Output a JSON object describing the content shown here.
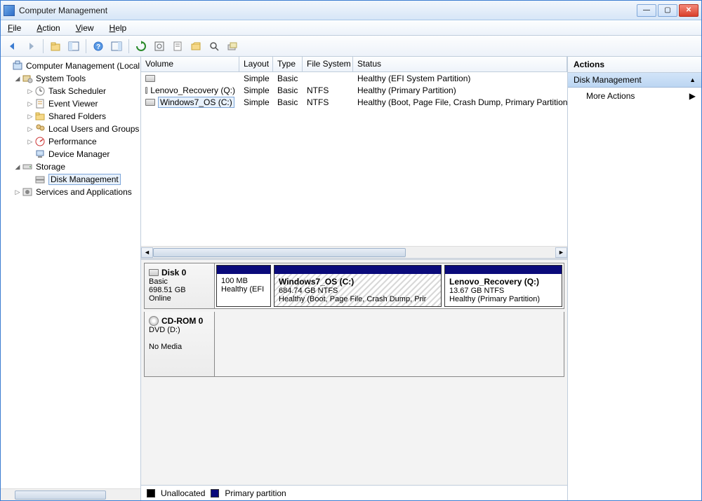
{
  "window": {
    "title": "Computer Management"
  },
  "menu": {
    "file": "File",
    "action": "Action",
    "view": "View",
    "help": "Help"
  },
  "tree": {
    "root": "Computer Management (Local",
    "system_tools": "System Tools",
    "task_scheduler": "Task Scheduler",
    "event_viewer": "Event Viewer",
    "shared_folders": "Shared Folders",
    "local_users": "Local Users and Groups",
    "performance": "Performance",
    "device_manager": "Device Manager",
    "storage": "Storage",
    "disk_management": "Disk Management",
    "services_apps": "Services and Applications"
  },
  "columns": {
    "volume": "Volume",
    "layout": "Layout",
    "type": "Type",
    "filesystem": "File System",
    "status": "Status"
  },
  "volumes": [
    {
      "name": "",
      "layout": "Simple",
      "type": "Basic",
      "fs": "",
      "status": "Healthy (EFI System Partition)"
    },
    {
      "name": "Lenovo_Recovery (Q:)",
      "layout": "Simple",
      "type": "Basic",
      "fs": "NTFS",
      "status": "Healthy (Primary Partition)"
    },
    {
      "name": "Windows7_OS (C:)",
      "layout": "Simple",
      "type": "Basic",
      "fs": "NTFS",
      "status": "Healthy (Boot, Page File, Crash Dump, Primary Partition"
    }
  ],
  "disk0": {
    "label": "Disk 0",
    "type": "Basic",
    "size": "698.51 GB",
    "status": "Online",
    "parts": [
      {
        "title": "",
        "sub1": "100 MB",
        "sub2": "Healthy (EFI"
      },
      {
        "title": "Windows7_OS  (C:)",
        "sub1": "684.74 GB NTFS",
        "sub2": "Healthy (Boot, Page File, Crash Dump, Prir"
      },
      {
        "title": "Lenovo_Recovery  (Q:)",
        "sub1": "13.67 GB NTFS",
        "sub2": "Healthy (Primary Partition)"
      }
    ]
  },
  "cdrom": {
    "label": "CD-ROM 0",
    "sub1": "DVD (D:)",
    "sub2": "No Media"
  },
  "legend": {
    "unallocated": "Unallocated",
    "primary": "Primary partition"
  },
  "actions": {
    "header": "Actions",
    "section": "Disk Management",
    "more": "More Actions"
  }
}
